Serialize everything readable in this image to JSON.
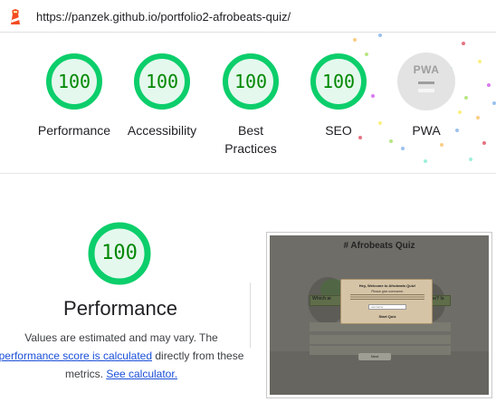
{
  "browser": {
    "url": "https://panzek.github.io/portfolio2-afrobeats-quiz/",
    "logo_icon": "lighthouse-icon"
  },
  "colors": {
    "pass_green": "#0cce6b",
    "pass_text": "#008800",
    "pwa_gray": "#9e9e9e",
    "link_blue": "#1a4fd8"
  },
  "categories": [
    {
      "label": "Performance",
      "score": "100"
    },
    {
      "label": "Accessibility",
      "score": "100"
    },
    {
      "label": "Best Practices",
      "score": "100"
    },
    {
      "label": "SEO",
      "score": "100"
    },
    {
      "label": "PWA",
      "badge": "PWA",
      "icon": "pwa-badge-icon"
    }
  ],
  "performance": {
    "score": "100",
    "title": "Performance",
    "desc_prefix": "Values are estimated and may vary. The ",
    "link1": "performance score is calculated",
    "desc_mid": " directly from these metrics. ",
    "link2": "See calculator."
  },
  "screenshot": {
    "title": "# Afrobeats Quiz",
    "modal_title": "Hey, Welcome to Afrobeats Quiz!",
    "modal_sub": "Please give username:",
    "input_placeholder": "username",
    "start_button": "Start Quiz",
    "left_label": "Which ar",
    "right_label": "iebe? Is",
    "next_button": "Next"
  }
}
